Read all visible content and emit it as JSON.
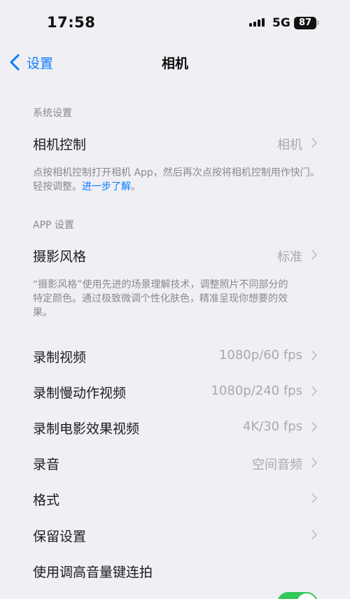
{
  "status_bar": {
    "time": "17:58",
    "network": "5G",
    "battery": "87"
  },
  "nav": {
    "back_label": "设置",
    "title": "相机"
  },
  "sections": {
    "system_header": "系统设置",
    "app_header": "APP 设置"
  },
  "camera_control": {
    "label": "相机控制",
    "value": "相机"
  },
  "camera_control_note": {
    "text": "点按相机控制打开相机 App，然后再次点按将相机控制用作快门。轻按调整。",
    "link": "进一步了解",
    "suffix": "。"
  },
  "photo_style": {
    "label": "摄影风格",
    "value": "标准"
  },
  "photo_style_note": "“摄影风格”使用先进的场景理解技术，调整照片不同部分的特定颜色。通过极致微调个性化肤色，精准呈现你想要的效果。",
  "rows": [
    {
      "label": "录制视频",
      "value": "1080p/60 fps"
    },
    {
      "label": "录制慢动作视频",
      "value": "1080p/240 fps"
    },
    {
      "label": "录制电影效果视频",
      "value": "4K/30 fps"
    },
    {
      "label": "录音",
      "value": "空间音频"
    },
    {
      "label": "格式",
      "value": ""
    },
    {
      "label": "保留设置",
      "value": ""
    },
    {
      "label": "使用调高音量键连拍",
      "value": ""
    }
  ],
  "colors": {
    "accent": "#0a7cff",
    "background": "#efeff4",
    "toggle_on": "#34c759"
  }
}
